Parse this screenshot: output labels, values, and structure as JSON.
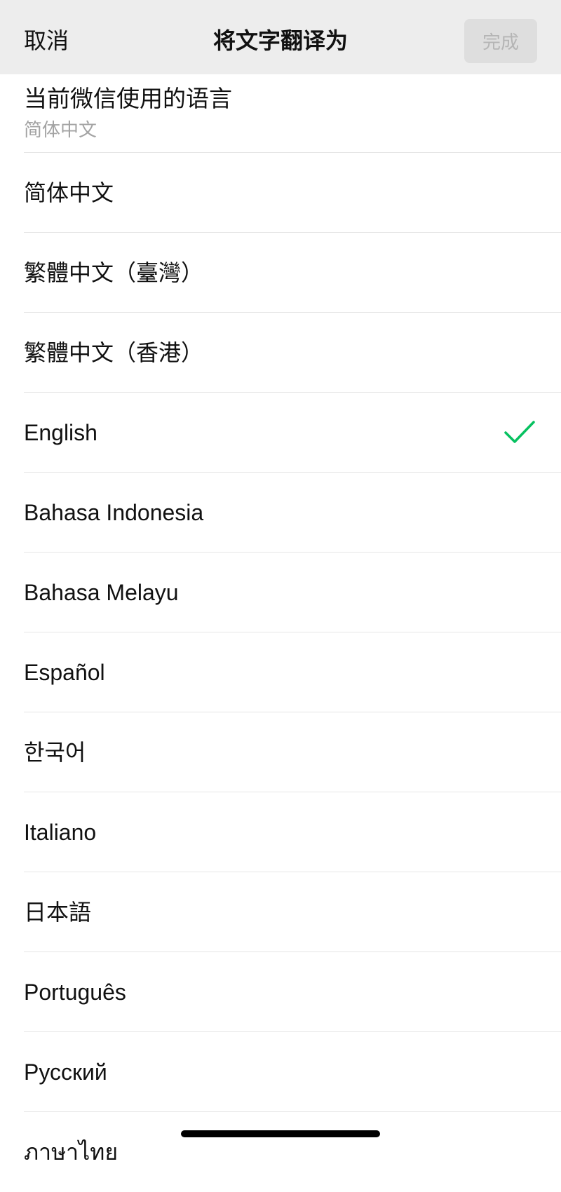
{
  "nav": {
    "cancel_label": "取消",
    "title": "将文字翻译为",
    "done_label": "完成"
  },
  "current_language": {
    "label": "当前微信使用的语言",
    "value": "简体中文"
  },
  "languages": [
    {
      "label": "简体中文",
      "selected": false
    },
    {
      "label": "繁體中文（臺灣）",
      "selected": false
    },
    {
      "label": "繁體中文（香港）",
      "selected": false
    },
    {
      "label": "English",
      "selected": true
    },
    {
      "label": "Bahasa Indonesia",
      "selected": false
    },
    {
      "label": "Bahasa Melayu",
      "selected": false
    },
    {
      "label": "Español",
      "selected": false
    },
    {
      "label": "한국어",
      "selected": false
    },
    {
      "label": "Italiano",
      "selected": false
    },
    {
      "label": "日本語",
      "selected": false
    },
    {
      "label": "Português",
      "selected": false
    },
    {
      "label": "Русский",
      "selected": false
    },
    {
      "label": "ภาษาไทย",
      "selected": false
    }
  ],
  "icons": {
    "selected": "checkmark-icon"
  },
  "colors": {
    "nav_background": "#ededed",
    "check": "#07c160",
    "done_disabled_bg": "#dedede",
    "done_disabled_text": "#b5b5b5",
    "secondary_text": "#a3a3a3"
  }
}
